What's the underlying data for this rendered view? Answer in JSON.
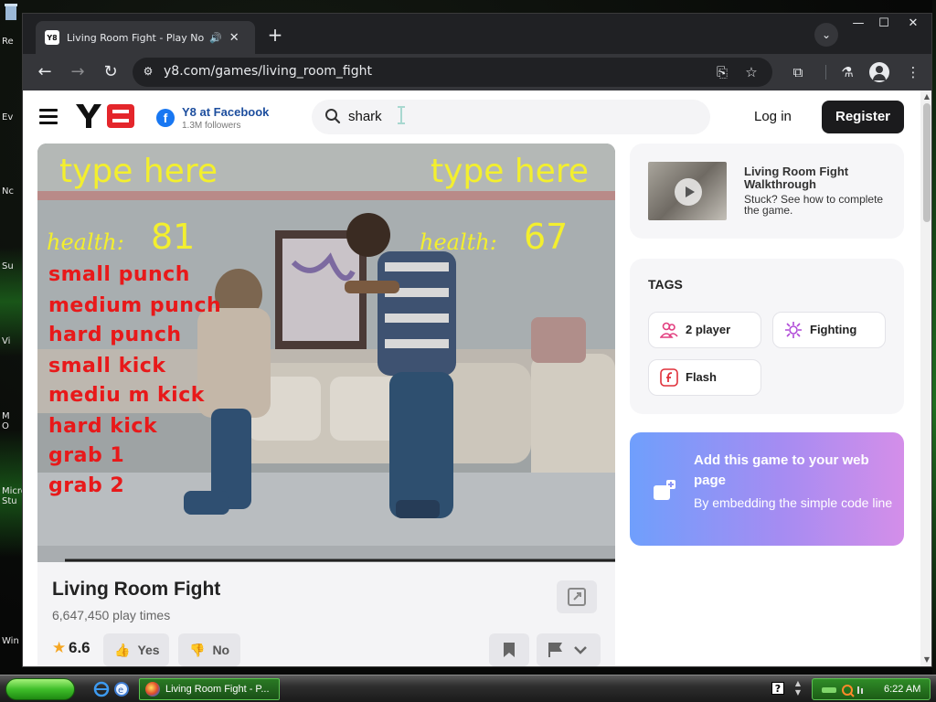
{
  "desktop": {
    "icon_labels": [
      "Re",
      "Ev",
      "Nc",
      "Su",
      "Vi",
      "M O",
      "Micro Stu",
      "Win"
    ]
  },
  "browser": {
    "tab": {
      "title": "Living Room Fight - Play Now",
      "favicon_text": "Y8",
      "audio_icon": "speaker-icon",
      "close_glyph": "✕"
    },
    "new_tab_glyph": "+",
    "url": "y8.com/games/living_room_fight",
    "window_controls": {
      "minimize": "—",
      "maximize": "☐",
      "close": "✕"
    }
  },
  "site": {
    "facebook": {
      "title": "Y8 at Facebook",
      "followers": "1.3M followers",
      "icon_glyph": "f"
    },
    "search": {
      "value": "shark"
    },
    "login_label": "Log in",
    "register_label": "Register",
    "colors": {
      "register_bg": "#1b1b1d",
      "facebook_blue": "#1877f2",
      "accent_gradient_start": "#6f9ffc",
      "accent_gradient_end": "#d48ee9"
    }
  },
  "game": {
    "p1_type_prompt": "type here",
    "p2_type_prompt": "type here",
    "health_label": "health:",
    "p1_health": "81",
    "p2_health": "67",
    "moves": [
      "small punch",
      "medium punch",
      "hard punch",
      "small kick",
      "mediu m kick",
      "hard kick",
      "grab 1",
      "grab 2"
    ]
  },
  "game_info": {
    "title": "Living Room Fight",
    "plays": "6,647,450 play times",
    "rating": "6.6",
    "yes_label": "Yes",
    "no_label": "No"
  },
  "walkthrough": {
    "title": "Living Room Fight Walkthrough",
    "desc": "Stuck? See how to complete the game."
  },
  "tags": {
    "heading": "TAGS",
    "items": [
      "2 player",
      "Fighting",
      "Flash"
    ]
  },
  "embed": {
    "title": "Add this game to your web page",
    "desc": "By embedding the simple code line"
  },
  "taskbar": {
    "task_label": "Living Room Fight - P...",
    "time": "6:22 AM",
    "help_glyph": "?"
  }
}
